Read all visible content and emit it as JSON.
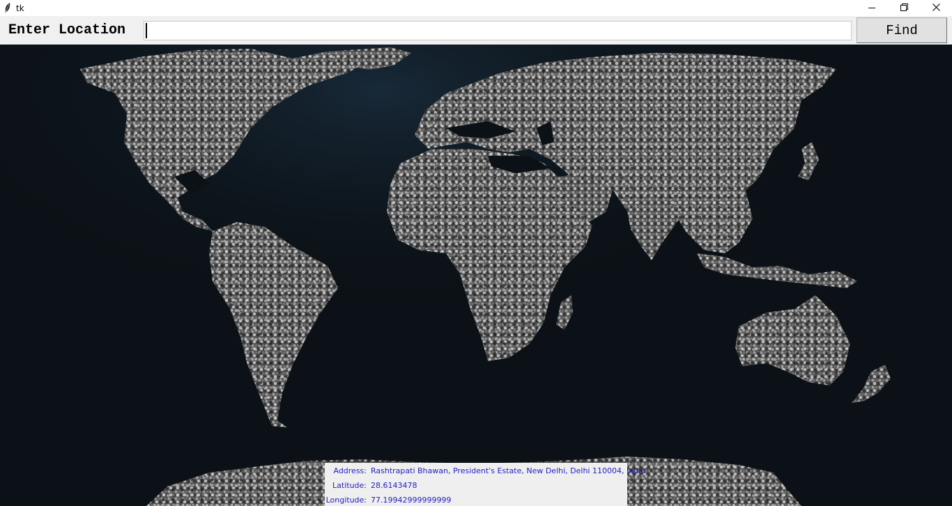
{
  "window": {
    "title": "tk",
    "controls": [
      "minimize-icon",
      "restore-icon",
      "close-icon"
    ]
  },
  "toolbar": {
    "label": "Enter Location",
    "input_value": "",
    "find_label": "Find"
  },
  "map": {
    "ocean_color": "#0b1116",
    "land_color": "#8a8a8a"
  },
  "info": {
    "address_label": "Address:",
    "address_value": "Rashtrapati Bhawan, President's Estate, New Delhi, Delhi 110004, India",
    "latitude_label": "Latitude:",
    "latitude_value": "28.6143478",
    "longitude_label": "Longitude:",
    "longitude_value": "77.19942999999999",
    "text_color": "#1f1fc0"
  }
}
